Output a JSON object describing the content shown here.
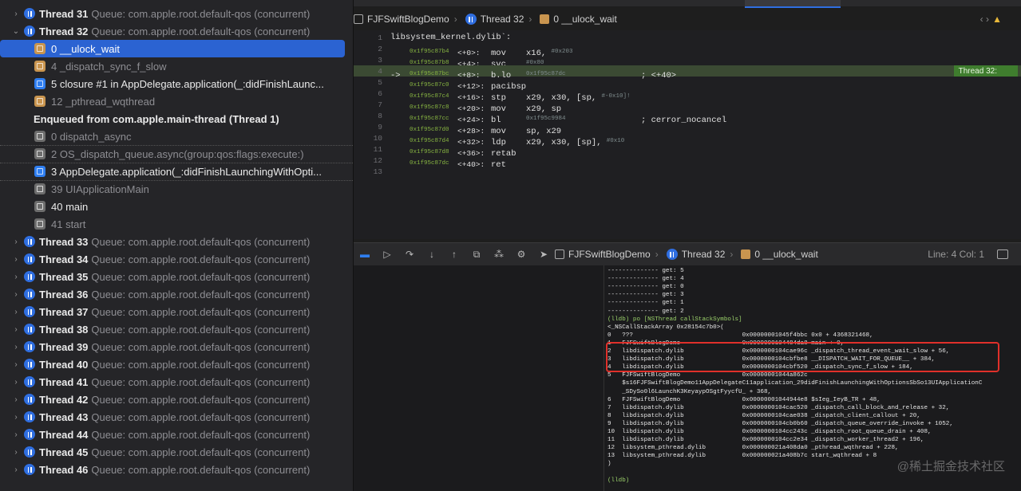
{
  "navigator": {
    "rows": [
      {
        "kind": "thread",
        "expanded": false,
        "name": "Thread 31",
        "queue": "Queue: com.apple.root.default-qos (concurrent)"
      },
      {
        "kind": "thread",
        "expanded": true,
        "name": "Thread 32",
        "queue": "Queue: com.apple.root.default-qos (concurrent)"
      },
      {
        "kind": "frame",
        "icon": "sys",
        "label": "0 __ulock_wait",
        "style": "selected"
      },
      {
        "kind": "frame",
        "icon": "sys",
        "label": "4 _dispatch_sync_f_slow",
        "style": "dim"
      },
      {
        "kind": "frame",
        "icon": "user",
        "label": "5 closure #1 in AppDelegate.application(_:didFinishLaunc...",
        "style": "bright"
      },
      {
        "kind": "frame",
        "icon": "sys",
        "label": "12 _pthread_wqthread",
        "style": "dim"
      },
      {
        "kind": "section",
        "label": "Enqueued from com.apple.main-thread (Thread 1)"
      },
      {
        "kind": "frame",
        "icon": "grey",
        "label": "0 dispatch_async",
        "style": "dim"
      },
      {
        "kind": "frame",
        "icon": "grey",
        "label": "2 OS_dispatch_queue.async(group:qos:flags:execute:)",
        "style": "dim"
      },
      {
        "kind": "frame",
        "icon": "user",
        "label": "3 AppDelegate.application(_:didFinishLaunchingWithOpti...",
        "style": "bright"
      },
      {
        "kind": "frame",
        "icon": "grey",
        "label": "39 UIApplicationMain",
        "style": "dim"
      },
      {
        "kind": "frame",
        "icon": "grey",
        "label": "40 main",
        "style": "bright"
      },
      {
        "kind": "frame",
        "icon": "grey",
        "label": "41 start",
        "style": "dim"
      },
      {
        "kind": "thread",
        "expanded": false,
        "name": "Thread 33",
        "queue": "Queue: com.apple.root.default-qos (concurrent)"
      },
      {
        "kind": "thread",
        "expanded": false,
        "name": "Thread 34",
        "queue": "Queue: com.apple.root.default-qos (concurrent)"
      },
      {
        "kind": "thread",
        "expanded": false,
        "name": "Thread 35",
        "queue": "Queue: com.apple.root.default-qos (concurrent)"
      },
      {
        "kind": "thread",
        "expanded": false,
        "name": "Thread 36",
        "queue": "Queue: com.apple.root.default-qos (concurrent)"
      },
      {
        "kind": "thread",
        "expanded": false,
        "name": "Thread 37",
        "queue": "Queue: com.apple.root.default-qos (concurrent)"
      },
      {
        "kind": "thread",
        "expanded": false,
        "name": "Thread 38",
        "queue": "Queue: com.apple.root.default-qos (concurrent)"
      },
      {
        "kind": "thread",
        "expanded": false,
        "name": "Thread 39",
        "queue": "Queue: com.apple.root.default-qos (concurrent)"
      },
      {
        "kind": "thread",
        "expanded": false,
        "name": "Thread 40",
        "queue": "Queue: com.apple.root.default-qos (concurrent)"
      },
      {
        "kind": "thread",
        "expanded": false,
        "name": "Thread 41",
        "queue": "Queue: com.apple.root.default-qos (concurrent)"
      },
      {
        "kind": "thread",
        "expanded": false,
        "name": "Thread 42",
        "queue": "Queue: com.apple.root.default-qos (concurrent)"
      },
      {
        "kind": "thread",
        "expanded": false,
        "name": "Thread 43",
        "queue": "Queue: com.apple.root.default-qos (concurrent)"
      },
      {
        "kind": "thread",
        "expanded": false,
        "name": "Thread 44",
        "queue": "Queue: com.apple.root.default-qos (concurrent)"
      },
      {
        "kind": "thread",
        "expanded": false,
        "name": "Thread 45",
        "queue": "Queue: com.apple.root.default-qos (concurrent)"
      },
      {
        "kind": "thread",
        "expanded": false,
        "name": "Thread 46",
        "queue": "Queue: com.apple.root.default-qos (concurrent)"
      }
    ]
  },
  "editor": {
    "breadcrumb": {
      "project": "FJFSwiftBlogDemo",
      "thread": "Thread 32",
      "frame": "0 __ulock_wait"
    },
    "lines": [
      {
        "n": "1",
        "text": "libsystem_kernel.dylib`:"
      },
      {
        "n": "2",
        "addr": "0x1f95c87b4",
        "off": "<+0>:",
        "mn": "mov",
        "ops": "x16, ",
        "cmt": "#0x203"
      },
      {
        "n": "3",
        "addr": "0x1f95c87b8",
        "off": "<+4>:",
        "mn": "svc",
        "ops": "",
        "cmt": "#0x80"
      },
      {
        "n": "4",
        "arrow": "->",
        "addr": "0x1f95c87bc",
        "off": "<+8>:",
        "mn": "b.lo",
        "ops": "",
        "cmt": "0x1f95c87dc",
        "tail": "; <+40>",
        "current": true
      },
      {
        "n": "5",
        "addr": "0x1f95c87c0",
        "off": "<+12>:",
        "mn": "pacibsp",
        "ops": "",
        "cmt": ""
      },
      {
        "n": "6",
        "addr": "0x1f95c87c4",
        "off": "<+16>:",
        "mn": "stp",
        "ops": "x29, x30, [sp, ",
        "cmt": "#-0x10]!"
      },
      {
        "n": "7",
        "addr": "0x1f95c87c8",
        "off": "<+20>:",
        "mn": "mov",
        "ops": "x29, sp",
        "cmt": ""
      },
      {
        "n": "8",
        "addr": "0x1f95c87cc",
        "off": "<+24>:",
        "mn": "bl",
        "ops": "",
        "cmt": "0x1f95c9984",
        "tail": "; cerror_nocancel"
      },
      {
        "n": "9",
        "addr": "0x1f95c87d0",
        "off": "<+28>:",
        "mn": "mov",
        "ops": "sp, x29",
        "cmt": ""
      },
      {
        "n": "10",
        "addr": "0x1f95c87d4",
        "off": "<+32>:",
        "mn": "ldp",
        "ops": "x29, x30, [sp], ",
        "cmt": "#0x10"
      },
      {
        "n": "11",
        "addr": "0x1f95c87d8",
        "off": "<+36>:",
        "mn": "retab",
        "ops": "",
        "cmt": ""
      },
      {
        "n": "12",
        "addr": "0x1f95c87dc",
        "off": "<+40>:",
        "mn": "ret",
        "ops": "",
        "cmt": ""
      },
      {
        "n": "13"
      }
    ],
    "thread_badge": "Thread 32:"
  },
  "debug_bar": {
    "breadcrumb": {
      "project": "FJFSwiftBlogDemo",
      "thread": "Thread 32",
      "frame": "0 __ulock_wait"
    },
    "position": "Line: 4  Col: 1"
  },
  "console": {
    "lines": [
      "-------------- get: 5",
      "-------------- get: 4",
      "-------------- get: 0",
      "-------------- get: 3",
      "-------------- get: 1",
      "-------------- get: 2",
      "(lldb) po [NSThread callStackSymbols]",
      "<_NSCallStackArray 0x28154c7b0>(",
      "0   ???                              0x00000001045f4bbc 0x0 + 4368321468,",
      "1   FJFSwiftBlogDemo                 0x0000000104484da8 main + 0,",
      "2   libdispatch.dylib                0x0000000104cae96c _dispatch_thread_event_wait_slow + 56,",
      "3   libdispatch.dylib                0x0000000104cbfbe8 __DISPATCH_WAIT_FOR_QUEUE__ + 384,",
      "4   libdispatch.dylib                0x0000000104cbf520 _dispatch_sync_f_slow + 184,",
      "5   FJFSwiftBlogDemo                 0x00000001044a862c",
      "    $s16FJFSwiftBlogDemo11AppDelegateC11application_29didFinishLaunchingWithOptionsSbSo13UIApplicationC",
      "    _SDySo0l6LaunchK3KeyaypOSgtFyycfU_ + 368,",
      "6   FJFSwiftBlogDemo                 0x00000001044944e8 $sIeg_IeyB_TR + 48,",
      "7   libdispatch.dylib                0x0000000104cac520 _dispatch_call_block_and_release + 32,",
      "8   libdispatch.dylib                0x0000000104cae038 _dispatch_client_callout + 20,",
      "9   libdispatch.dylib                0x0000000104cb0b60 _dispatch_queue_override_invoke + 1052,",
      "10  libdispatch.dylib                0x0000000104cc243c _dispatch_root_queue_drain + 408,",
      "11  libdispatch.dylib                0x0000000104cc2e34 _dispatch_worker_thread2 + 196,",
      "12  libsystem_pthread.dylib          0x000000021a408da0 _pthread_wqthread + 228,",
      "13  libsystem_pthread.dylib          0x000000021a408b7c start_wqthread + 8",
      ")",
      "",
      "(lldb)"
    ]
  },
  "watermark": "@稀土掘金技术社区",
  "colors": {
    "accent": "#2b63d2",
    "highlight": "#e0302a",
    "current_line": "#3b4a33"
  }
}
